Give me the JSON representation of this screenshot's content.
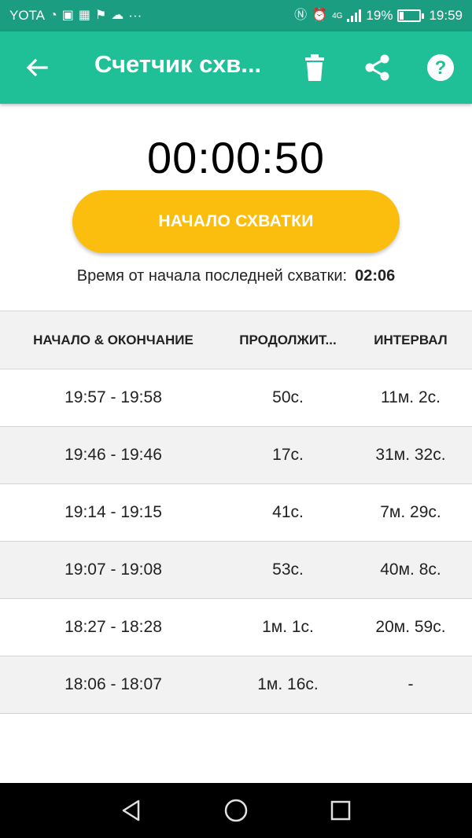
{
  "status_bar": {
    "carrier": "YOTA",
    "dots": "···",
    "network": "4G",
    "battery_percent": "19%",
    "time": "19:59"
  },
  "app_bar": {
    "title": "Счетчик схв...",
    "icons": [
      "back-arrow-icon",
      "trash-icon",
      "share-icon",
      "help-icon"
    ]
  },
  "timer": "00:00:50",
  "start_button": "НАЧАЛО СХВАТКИ",
  "since_last": {
    "label": "Время от начала последней схватки:",
    "value": "02:06"
  },
  "table": {
    "headers": [
      "НАЧАЛО & ОКОНЧАНИЕ",
      "ПРОДОЛЖИТ...",
      "ИНТЕРВАЛ"
    ],
    "rows": [
      {
        "range": "19:57 - 19:58",
        "duration": "50с.",
        "interval": "11м. 2с."
      },
      {
        "range": "19:46 - 19:46",
        "duration": "17с.",
        "interval": "31м. 32с."
      },
      {
        "range": "19:14 - 19:15",
        "duration": "41с.",
        "interval": "7м. 29с."
      },
      {
        "range": "19:07 - 19:08",
        "duration": "53с.",
        "interval": "40м. 8с."
      },
      {
        "range": "18:27 - 18:28",
        "duration": "1м. 1с.",
        "interval": "20м. 59с."
      },
      {
        "range": "18:06 - 18:07",
        "duration": "1м. 16с.",
        "interval": "-"
      }
    ]
  },
  "colors": {
    "status_bar": "#1a9d80",
    "app_bar": "#1fbf97",
    "accent_button": "#fbbe0f",
    "row_alt": "#f2f2f2"
  },
  "nav_bar": {
    "icons": [
      "back-triangle-icon",
      "home-circle-icon",
      "recents-square-icon"
    ]
  }
}
